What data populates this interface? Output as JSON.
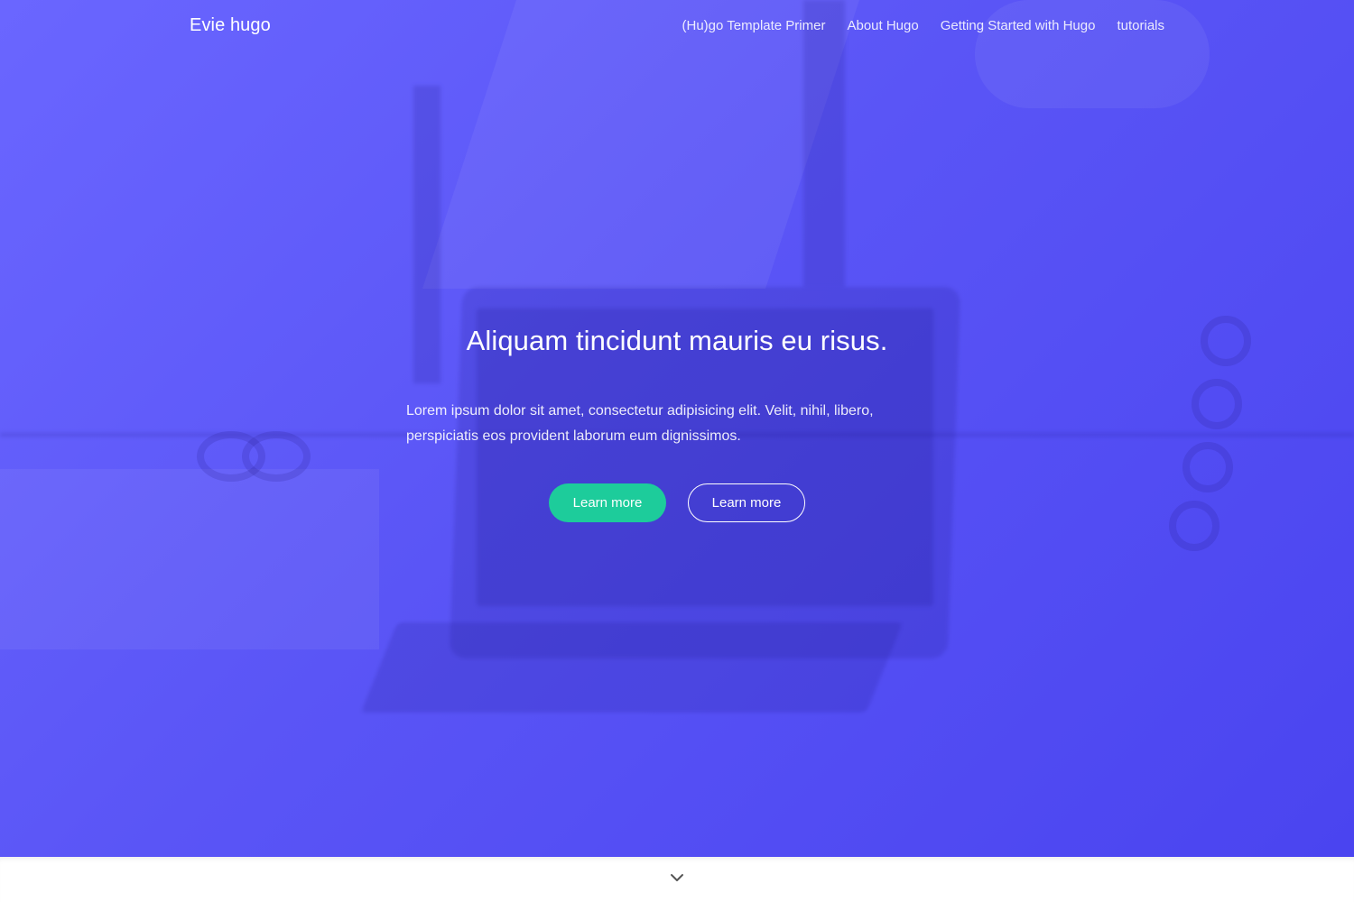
{
  "header": {
    "brand": "Evie hugo",
    "nav": [
      {
        "label": "(Hu)go Template Primer"
      },
      {
        "label": "About Hugo"
      },
      {
        "label": "Getting Started with Hugo"
      },
      {
        "label": "tutorials"
      }
    ]
  },
  "hero": {
    "title": "Aliquam tincidunt mauris eu risus.",
    "text": "Lorem ipsum dolor sit amet, consectetur adipisicing elit. Velit, nihil, libero, perspiciatis eos provident laborum eum dignissimos.",
    "primary_button": "Learn more",
    "secondary_button": "Learn more"
  },
  "icons": {
    "scroll": "chevron-down-icon"
  },
  "colors": {
    "hero_overlay": "#5a55f6",
    "primary_button": "#1dcc9b",
    "text": "#ffffff",
    "chevron": "#555555"
  }
}
